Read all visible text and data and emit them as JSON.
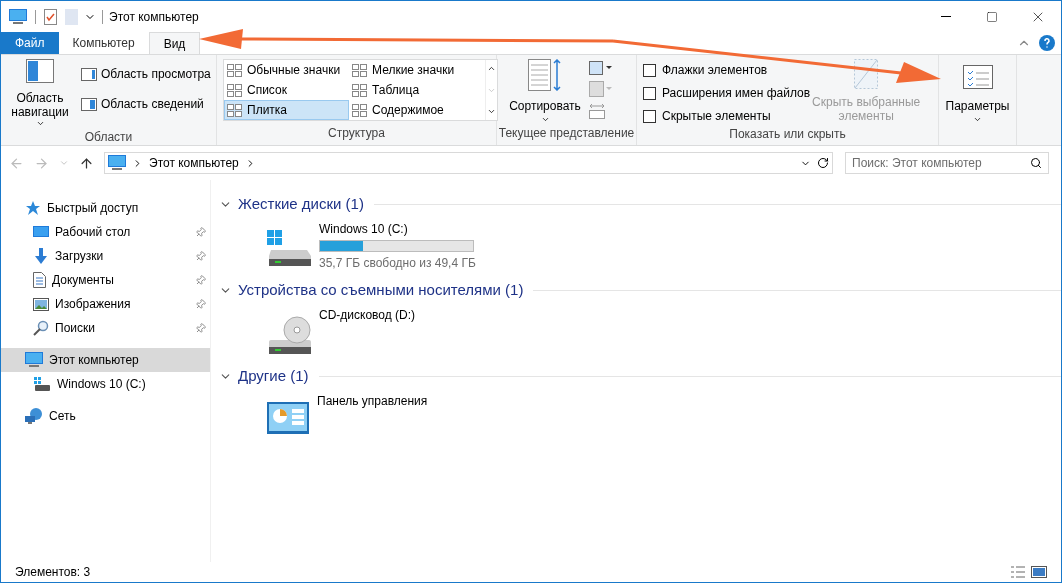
{
  "window": {
    "title": "Этот компьютер"
  },
  "tabs": [
    {
      "label": "Файл",
      "kind": "file",
      "selected": false
    },
    {
      "label": "Компьютер",
      "kind": "tab",
      "selected": false
    },
    {
      "label": "Вид",
      "kind": "tab",
      "selected": true
    }
  ],
  "ribbon": {
    "areas": {
      "nav_button": "Область навигации",
      "panes": [
        "Область просмотра",
        "Область сведений"
      ],
      "label": "Области"
    },
    "structure": {
      "layouts": [
        {
          "label": "Обычные значки",
          "selected": false
        },
        {
          "label": "Мелкие значки",
          "selected": false
        },
        {
          "label": "Список",
          "selected": false
        },
        {
          "label": "Таблица",
          "selected": false
        },
        {
          "label": "Плитка",
          "selected": true
        },
        {
          "label": "Содержимое",
          "selected": false
        }
      ],
      "label": "Структура"
    },
    "current_view": {
      "sort_button": "Сортировать",
      "label": "Текущее представление"
    },
    "show_hide": {
      "checkboxes": [
        {
          "label": "Флажки элементов",
          "checked": false
        },
        {
          "label": "Расширения имен файлов",
          "checked": false
        },
        {
          "label": "Скрытые элементы",
          "checked": false
        }
      ],
      "hide_selected": {
        "label": "Скрыть выбранные элементы",
        "disabled": true
      },
      "label": "Показать или скрыть"
    },
    "options": {
      "label": "Параметры"
    }
  },
  "address": {
    "path": "Этот компьютер",
    "search_placeholder": "Поиск: Этот компьютер"
  },
  "nav": [
    {
      "label": "Быстрый доступ",
      "kind": "star",
      "selected": false,
      "children": [
        {
          "label": "Рабочий стол",
          "kind": "desktop",
          "pinned": true,
          "selected": false
        },
        {
          "label": "Загрузки",
          "kind": "download",
          "pinned": true,
          "selected": false
        },
        {
          "label": "Документы",
          "kind": "document",
          "pinned": true,
          "selected": false
        },
        {
          "label": "Изображения",
          "kind": "image",
          "pinned": true,
          "selected": false
        },
        {
          "label": "Поиски",
          "kind": "search",
          "pinned": true,
          "selected": false
        }
      ]
    },
    {
      "label": "Этот компьютер",
      "kind": "computer",
      "selected": true,
      "children": [
        {
          "label": "Windows 10 (C:)",
          "kind": "drive",
          "pinned": false,
          "selected": false
        }
      ]
    },
    {
      "label": "Сеть",
      "kind": "network",
      "selected": false
    }
  ],
  "groups": [
    {
      "title": "Жесткие диски (1)",
      "items": [
        {
          "name": "Windows 10 (C:)",
          "kind": "disk",
          "level": 0.28,
          "reading": "35,7 ГБ свободно из 49,4 ГБ"
        }
      ]
    },
    {
      "title": "Устройства со съемными носителями (1)",
      "items": [
        {
          "name": "CD-дисковод (D:)",
          "kind": "cd"
        }
      ]
    },
    {
      "title": "Другие (1)",
      "items": [
        {
          "name": "Панель управления",
          "kind": "control_panel"
        }
      ]
    }
  ],
  "status_bar": {
    "count": "Элементов: 3"
  }
}
